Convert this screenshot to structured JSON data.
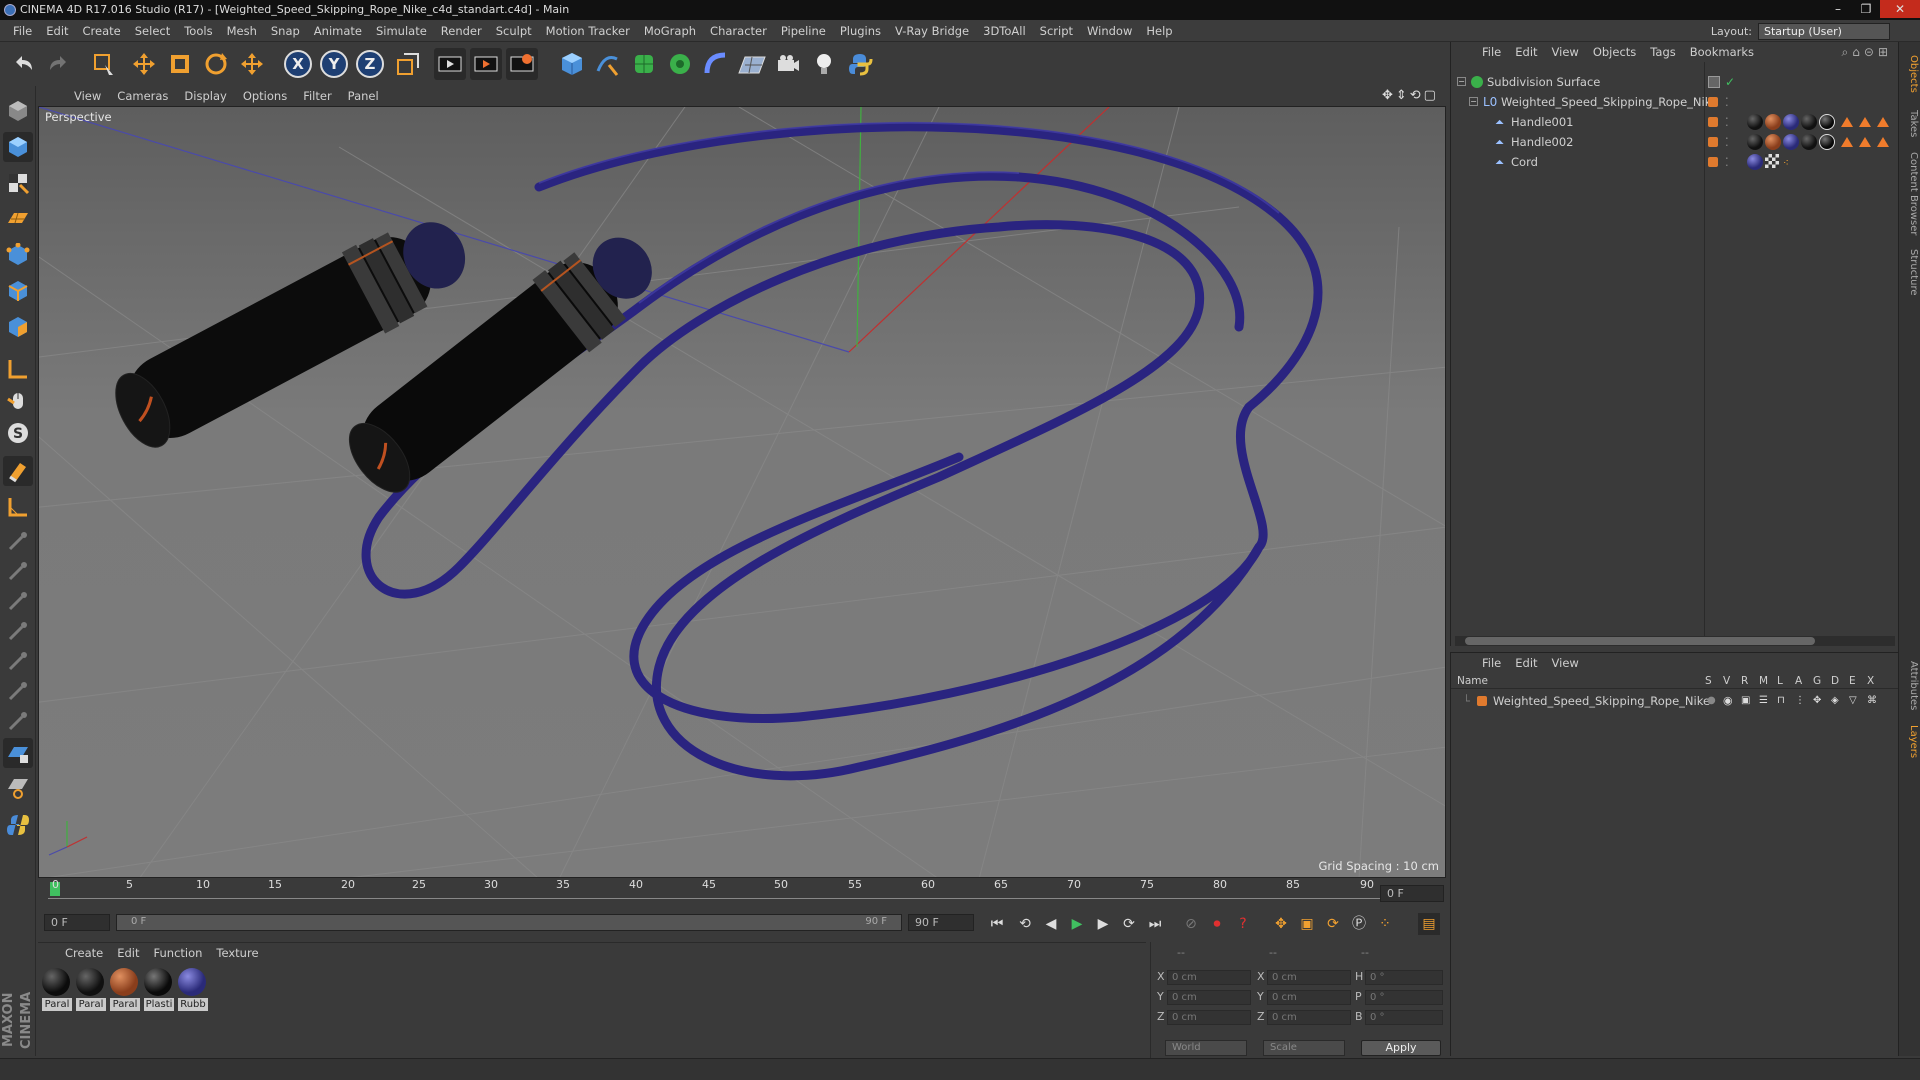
{
  "window": {
    "title": "CINEMA 4D R17.016 Studio (R17) - [Weighted_Speed_Skipping_Rope_Nike_c4d_standart.c4d] - Main",
    "layout_label": "Layout:",
    "layout_value": "Startup (User)"
  },
  "menubar": [
    "File",
    "Edit",
    "Create",
    "Select",
    "Tools",
    "Mesh",
    "Snap",
    "Animate",
    "Simulate",
    "Render",
    "Sculpt",
    "Motion Tracker",
    "MoGraph",
    "Character",
    "Pipeline",
    "Plugins",
    "V-Ray Bridge",
    "3DToAll",
    "Script",
    "Window",
    "Help"
  ],
  "toolbar": {
    "axis_x": "X",
    "axis_y": "Y",
    "axis_z": "Z"
  },
  "viewport": {
    "menu": [
      "View",
      "Cameras",
      "Display",
      "Options",
      "Filter",
      "Panel"
    ],
    "label": "Perspective",
    "grid_spacing": "Grid Spacing : 10 cm"
  },
  "timeline": {
    "ticks": [
      "0",
      "5",
      "10",
      "15",
      "20",
      "25",
      "30",
      "35",
      "40",
      "45",
      "50",
      "55",
      "60",
      "65",
      "70",
      "75",
      "80",
      "85",
      "90"
    ],
    "current_frame": "0 F",
    "start_field": "0 F",
    "range_start": "0 F",
    "range_end": "90 F",
    "end_field": "90 F"
  },
  "materials": {
    "menu": [
      "Create",
      "Edit",
      "Function",
      "Texture"
    ],
    "items": [
      {
        "label": "Paral",
        "color": "#0c0c0c"
      },
      {
        "label": "Paral",
        "color": "#101010"
      },
      {
        "label": "Paral",
        "color": "#8a3e1c"
      },
      {
        "label": "Plasti",
        "color": "#0a0a0a"
      },
      {
        "label": "Rubb",
        "color": "#2a2a78"
      }
    ]
  },
  "coords": {
    "head1": "--",
    "head2": "--",
    "head3": "--",
    "x_label": "X",
    "y_label": "Y",
    "z_label": "Z",
    "x2_label": "X",
    "y2_label": "Y",
    "z2_label": "Z",
    "h_label": "H",
    "p_label": "P",
    "b_label": "B",
    "pos_x": "0 cm",
    "pos_y": "0 cm",
    "pos_z": "0 cm",
    "size_x": "0 cm",
    "size_y": "0 cm",
    "size_z": "0 cm",
    "rot_h": "0 °",
    "rot_p": "0 °",
    "rot_b": "0 °",
    "mode1": "World",
    "mode2": "Scale",
    "apply": "Apply"
  },
  "objects": {
    "menu": [
      "File",
      "Edit",
      "View",
      "Objects",
      "Tags",
      "Bookmarks"
    ],
    "rows": [
      {
        "name": "Subdivision Surface"
      },
      {
        "name": "Weighted_Speed_Skipping_Rope_Nike"
      },
      {
        "name": "Handle001"
      },
      {
        "name": "Handle002"
      },
      {
        "name": "Cord"
      }
    ]
  },
  "layers": {
    "menu": [
      "File",
      "Edit",
      "View"
    ],
    "head_name": "Name",
    "cols": [
      "S",
      "V",
      "R",
      "M",
      "L",
      "A",
      "G",
      "D",
      "E",
      "X"
    ],
    "rows": [
      {
        "name": "Weighted_Speed_Skipping_Rope_Nike"
      }
    ]
  },
  "side_tabs": [
    "Objects",
    "Takes",
    "Content Browser",
    "Structure",
    "Attributes",
    "Layers"
  ],
  "brand": "MAXON CINEMA 4D",
  "colors": {
    "accent_orange": "#f0a030",
    "rope_blue": "#2a2480",
    "layer_orange": "#e07a2e"
  }
}
